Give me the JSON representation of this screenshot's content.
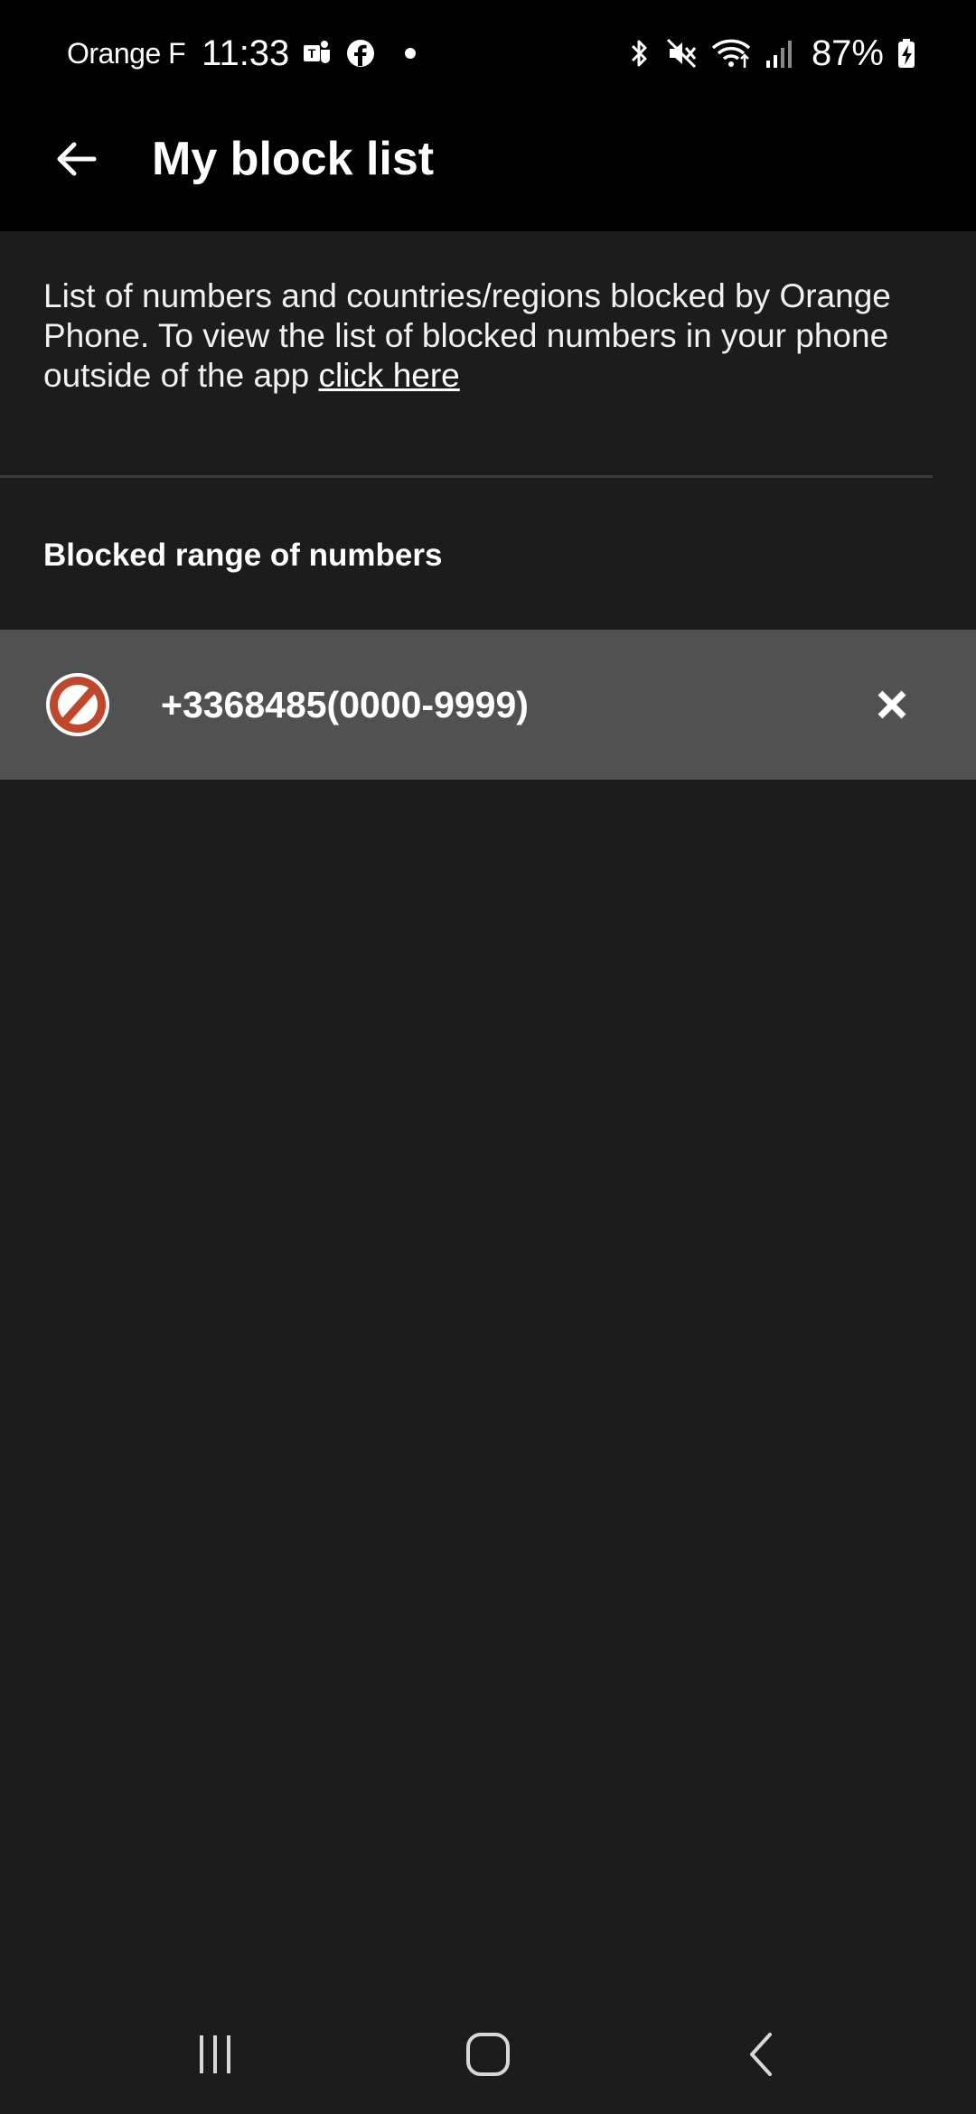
{
  "status_bar": {
    "carrier": "Orange F",
    "time": "11:33",
    "battery_percent": "87%",
    "icons_left": [
      "teams-icon",
      "facebook-icon",
      "notification-dot"
    ],
    "icons_right": [
      "bluetooth-icon",
      "mute-icon",
      "wifi-icon",
      "signal-icon",
      "battery-charging-icon"
    ]
  },
  "app_bar": {
    "title": "My block list",
    "back_icon": "arrow-left-icon"
  },
  "description": {
    "text": "List of numbers and countries/regions blocked by Orange Phone. To view the list of blocked numbers in your phone outside of the app ",
    "link_text": "click here"
  },
  "section": {
    "header": "Blocked range of numbers"
  },
  "blocked_items": [
    {
      "number": "+3368485(0000-9999)",
      "icon": "block-icon",
      "remove_icon": "close-icon"
    }
  ],
  "colors": {
    "background": "#1c1c1c",
    "bar_background": "#000000",
    "row_background": "#515151",
    "block_icon_red": "#c0472c",
    "divider": "#3a3a3a",
    "text": "#ffffff"
  },
  "nav_bar": {
    "buttons": [
      "recent-apps-icon",
      "home-icon",
      "back-nav-icon"
    ]
  }
}
